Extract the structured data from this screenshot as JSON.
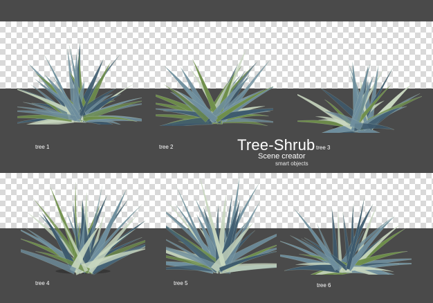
{
  "title": "Tree-Shrub",
  "subtitle": "Scene creator",
  "subtitle2": "smart objects",
  "plants": [
    {
      "label": "tree 1"
    },
    {
      "label": "tree 2"
    },
    {
      "label": "tree 3"
    },
    {
      "label": "tree 4"
    },
    {
      "label": "tree 5"
    },
    {
      "label": "tree 6"
    }
  ],
  "colors": {
    "background": "#4a4a4a",
    "checker_light": "#ffffff",
    "checker_dark": "#d9d9d9",
    "leaf_dark": "#3d5a6e",
    "leaf_mid": "#6e8e9e",
    "leaf_light": "#c9d8c0",
    "leaf_green": "#6f8f4a"
  }
}
